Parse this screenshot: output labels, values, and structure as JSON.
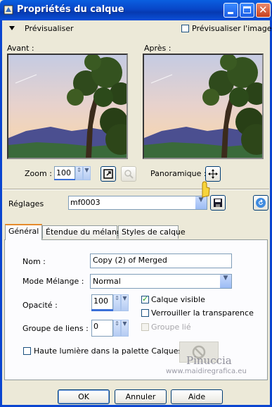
{
  "window": {
    "title": "Propriétés du calque"
  },
  "preview_section": {
    "toggle_label": "Prévisualiser",
    "preview_image_label": "Prévisualiser l'image",
    "before_label": "Avant :",
    "after_label": "Après :",
    "zoom_label": "Zoom :",
    "zoom_value": "100",
    "pan_label": "Panoramique :"
  },
  "presets": {
    "label": "Réglages",
    "value": "mf0003"
  },
  "tabs": [
    {
      "label": "Général",
      "active": true
    },
    {
      "label": "Étendue du mélange",
      "active": false
    },
    {
      "label": "Styles de calque",
      "active": false
    }
  ],
  "general": {
    "name_label": "Nom :",
    "name_value": "Copy (2) of Merged",
    "blend_mode_label": "Mode Mélange :",
    "blend_mode_value": "Normal",
    "opacity_label": "Opacité :",
    "opacity_value": "100",
    "link_group_label": "Groupe de liens :",
    "link_group_value": "0",
    "visible_label": "Calque visible",
    "visible_checked": true,
    "lock_transparency_label": "Verrouiller la transparence",
    "lock_transparency_checked": false,
    "group_linked_label": "Groupe lié",
    "highlight_label": "Haute lumière dans la palette Calques :"
  },
  "buttons": {
    "ok": "OK",
    "cancel": "Annuler",
    "help": "Aide"
  },
  "watermark": {
    "line1": "Pinuccia",
    "line2": "www.maidiregrafica.eu"
  },
  "colors": {
    "titlebar": "#0846c8",
    "dialog_bg": "#ece9d8",
    "tab_accent": "#e68b2c"
  }
}
